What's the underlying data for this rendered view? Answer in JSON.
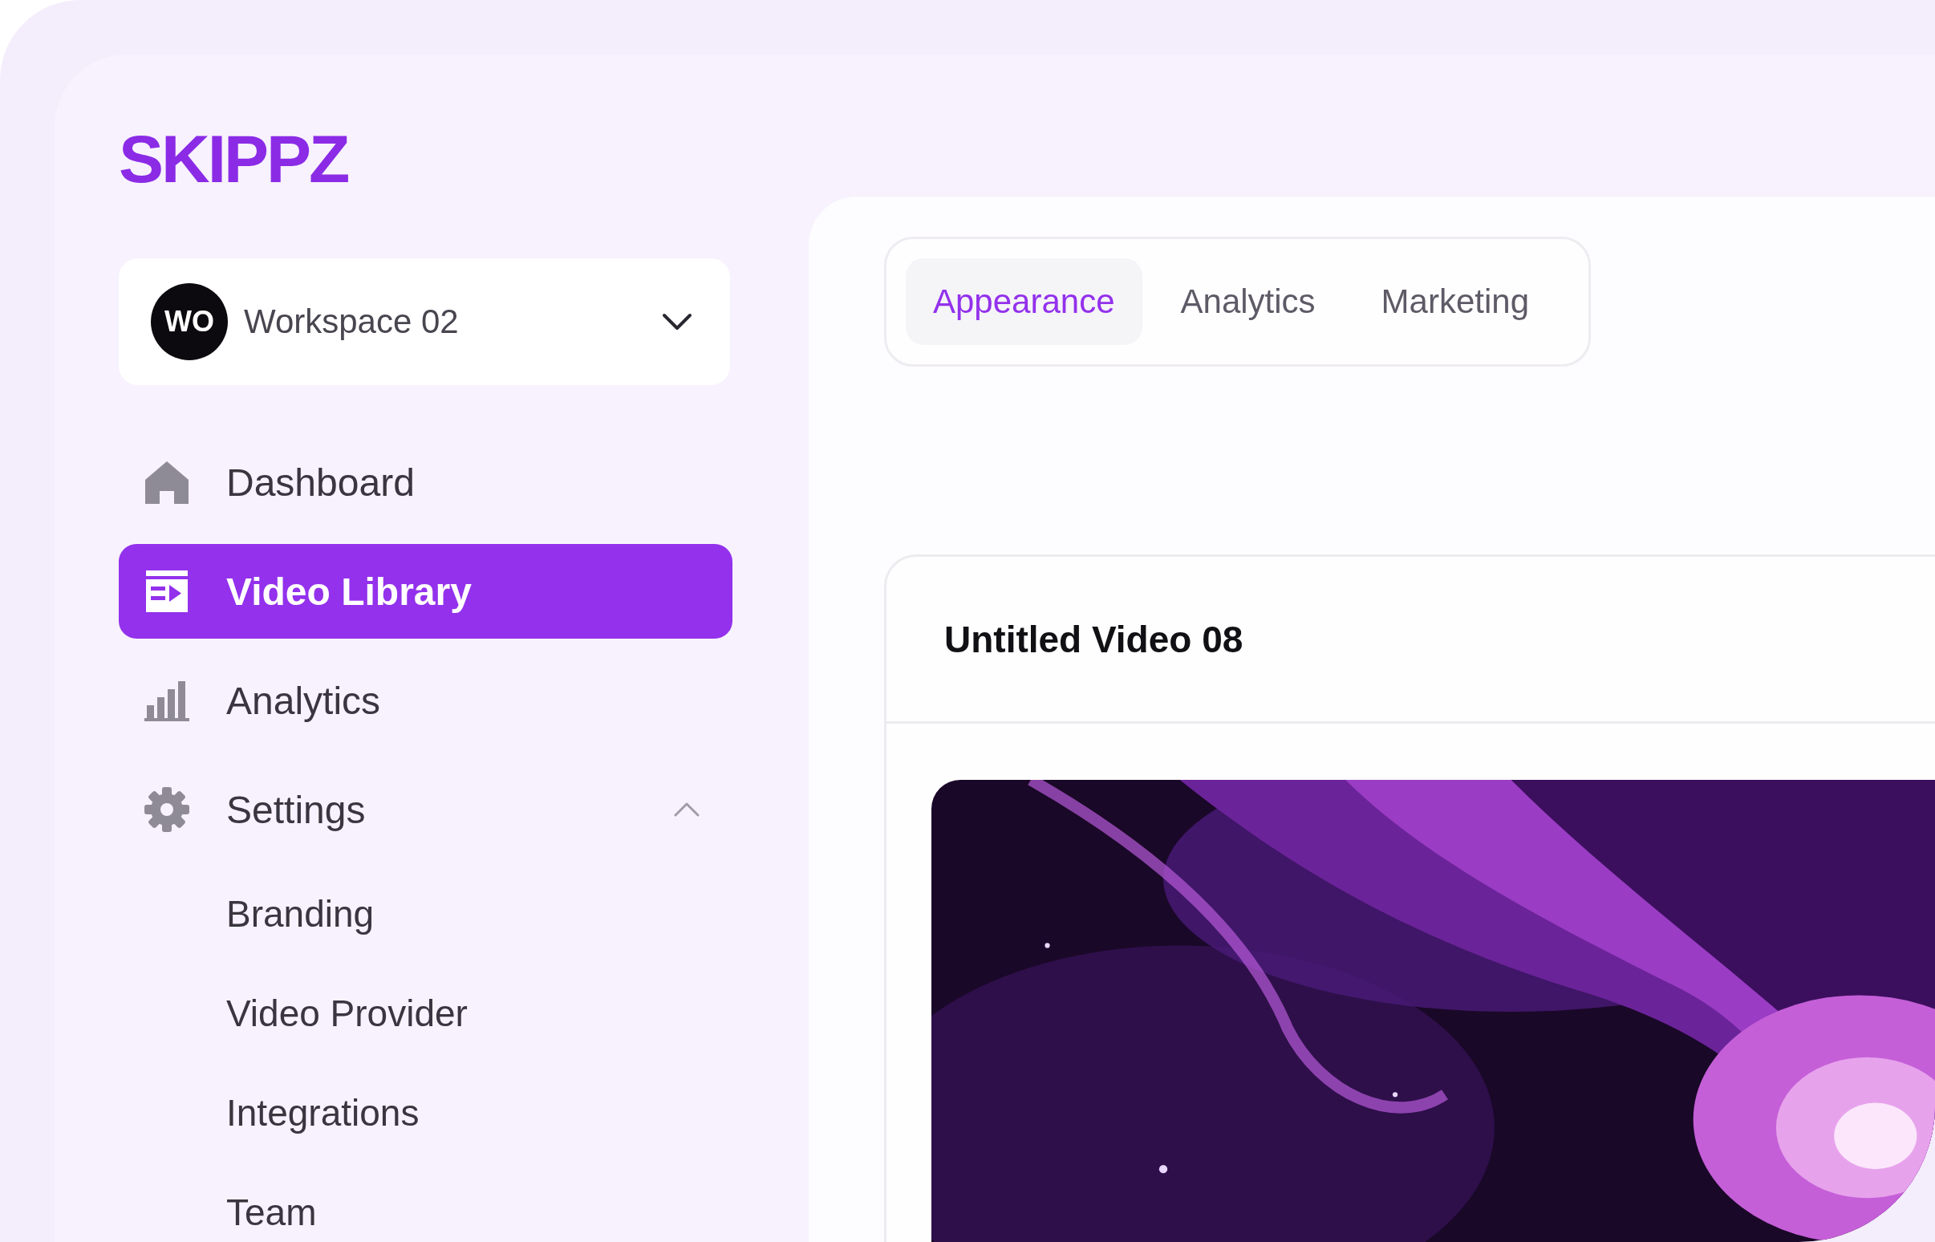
{
  "logo": {
    "text": "SKIPPZ"
  },
  "workspace": {
    "avatar": "WO",
    "name": "Workspace 02"
  },
  "nav": [
    {
      "label": "Dashboard",
      "selected": false
    },
    {
      "label": "Video Library",
      "selected": true
    },
    {
      "label": "Analytics",
      "selected": false
    },
    {
      "label": "Settings",
      "selected": false,
      "expanded": true,
      "children": [
        {
          "label": "Branding",
          "selected": false
        },
        {
          "label": "Video Provider",
          "selected": false
        },
        {
          "label": "Integrations",
          "selected": false
        },
        {
          "label": "Team",
          "selected": false
        }
      ]
    }
  ],
  "tabs": [
    {
      "label": "Appearance",
      "selected": true
    },
    {
      "label": "Analytics",
      "selected": false
    },
    {
      "label": "Marketing",
      "selected": false
    }
  ],
  "video": {
    "title": "Untitled Video 08",
    "kind": "picture"
  }
}
